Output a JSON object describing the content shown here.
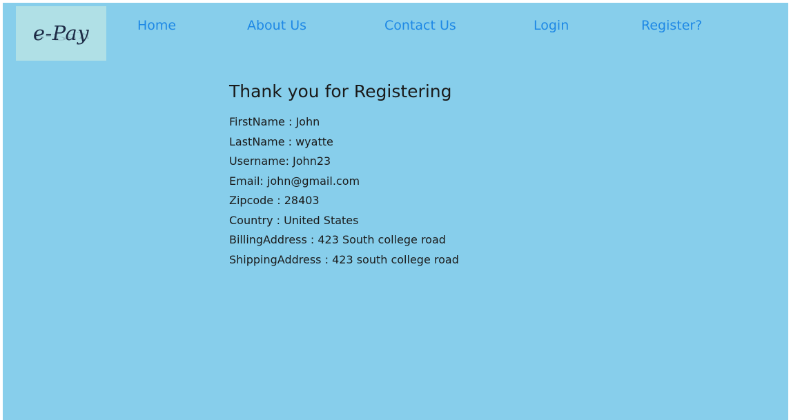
{
  "logo": {
    "text": "e-Pay"
  },
  "nav": {
    "home": "Home",
    "about": "About Us",
    "contact": "Contact Us",
    "login": "Login",
    "register": "Register?"
  },
  "main": {
    "title": "Thank you for Registering",
    "details": [
      "FirstName : John",
      "LastName : wyatte",
      "Username: John23",
      "Email: john@gmail.com",
      "Zipcode : 28403",
      "Country : United States",
      "BillingAddress : 423 South college road",
      "ShippingAddress : 423 south college road"
    ]
  },
  "colors": {
    "background": "#87ceeb",
    "logo_background": "#b0e0e6",
    "nav_link": "#1e88e5",
    "text": "#1a1a1a"
  }
}
